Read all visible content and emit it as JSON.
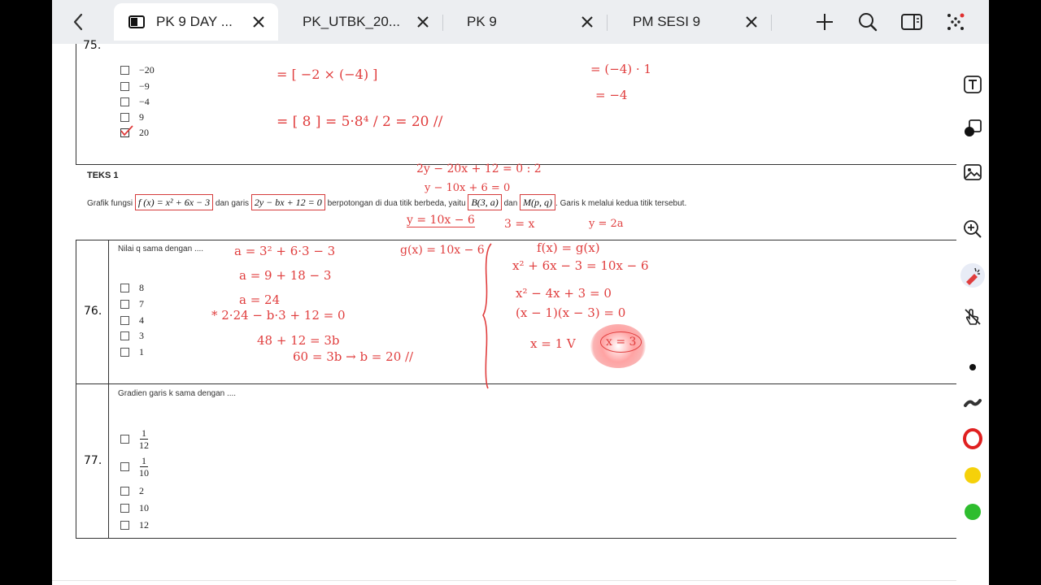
{
  "tabs": [
    {
      "label": "PK 9 DAY ...",
      "active": true
    },
    {
      "label": "PK_UTBK_20..."
    },
    {
      "label": "PK 9"
    },
    {
      "label": "PM SESI 9"
    }
  ],
  "q75": {
    "number": "75.",
    "options": [
      "−20",
      "−9",
      "−4",
      "9",
      "20"
    ]
  },
  "teks1": {
    "title": "TEKS 1",
    "p1": "Grafik fungsi",
    "f": "f (x) = x² + 6x − 3",
    "p2": "dan garis",
    "g": "2y − bx + 12 = 0",
    "p3": "berpotongan di dua titik berbeda, yaitu",
    "B": "B(3, a)",
    "p4": "dan",
    "M": "M(p, q)",
    "p5": ". Garis k melalui kedua titik tersebut."
  },
  "q76": {
    "number": "76.",
    "question": "Nilai q sama dengan ....",
    "options": [
      "8",
      "7",
      "4",
      "3",
      "1"
    ]
  },
  "q77": {
    "number": "77.",
    "question": "Gradien garis k sama dengan ....",
    "options": [
      {
        "num": "1",
        "den": "12"
      },
      {
        "num": "1",
        "den": "10"
      },
      {
        "text": "2"
      },
      {
        "text": "10"
      },
      {
        "text": "12"
      }
    ]
  },
  "handwriting": {
    "l1": "= [ −2 × (−4) ]",
    "l2": "= [ 8 ]  =  5·8⁴ / 2  = 20 //",
    "r1": "= (−4) · 1",
    "r2": "= −4",
    "t1": "2y − 20x + 12 = 0   : 2",
    "t2": "y − 10x + 6 = 0",
    "t3": "y = 10x − 6",
    "t4": "3 = x",
    "t5": "y = 2a",
    "a1": "a = 3² + 6·3 − 3",
    "a2": "a = 9 + 18 − 3",
    "a3": "a = 24",
    "a4": "* 2·24 − b·3 + 12 = 0",
    "a5": "48 + 12 = 3b",
    "a6": "60 = 3b → b = 20 //",
    "g1": "g(x) = 10x − 6",
    "c1": "f(x) = g(x)",
    "c2": "x² + 6x − 3 = 10x − 6",
    "c3": "x² − 4x + 3 = 0",
    "c4": "(x − 1)(x − 3) = 0",
    "c5": "x = 1   V",
    "c6": "x = 3"
  },
  "colors": {
    "ink": "#e03d3d",
    "tabbar": "#eceef1",
    "tools": [
      "#111111",
      "#333333",
      "#e02020",
      "#f5d10a",
      "#2ebd2e"
    ]
  }
}
